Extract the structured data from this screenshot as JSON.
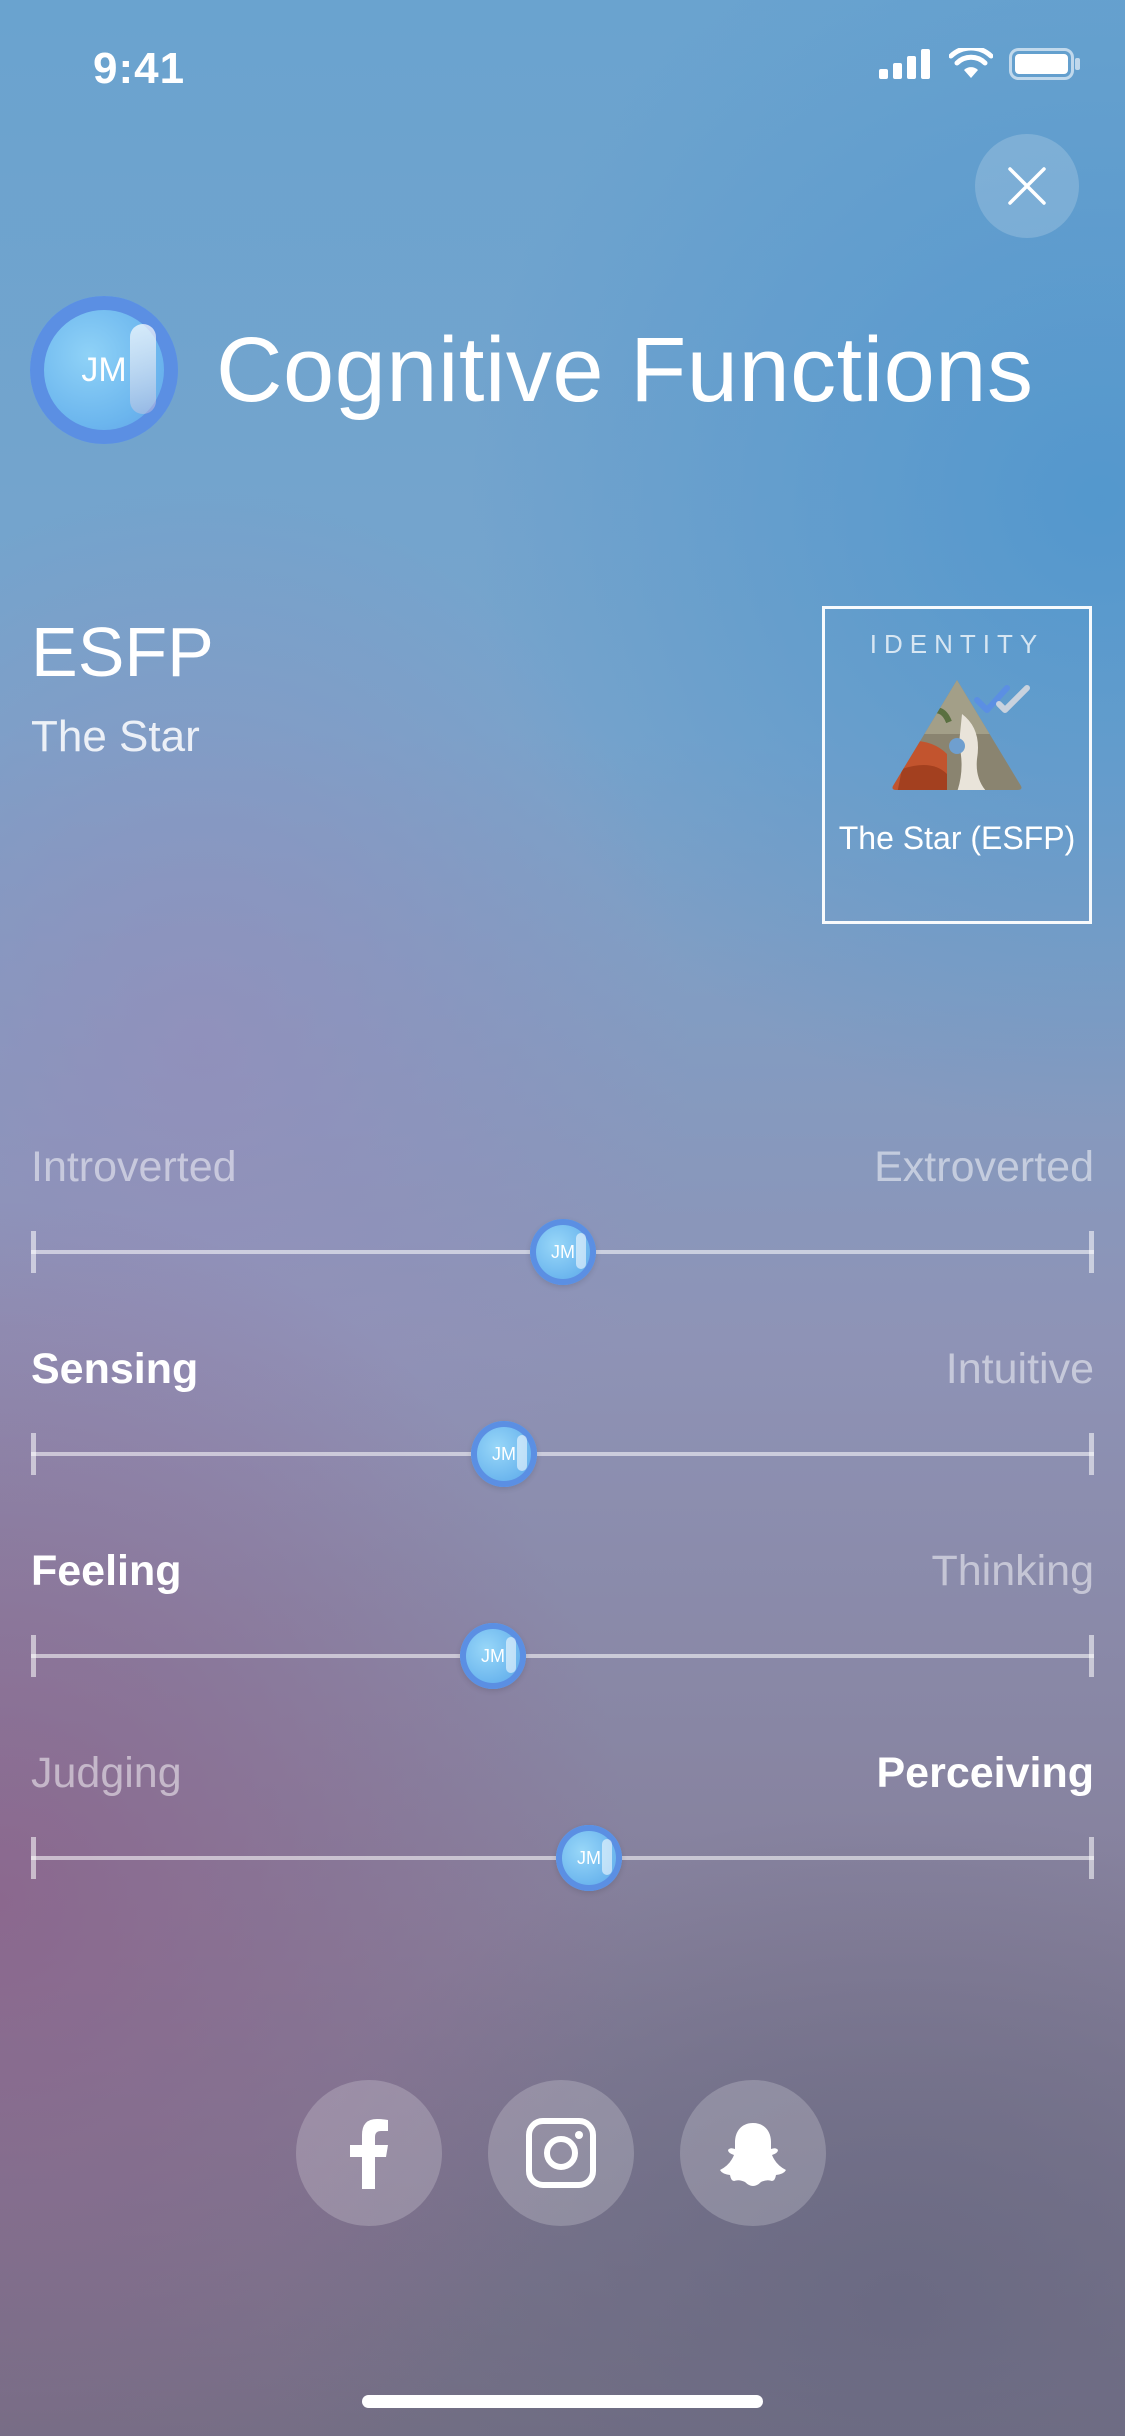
{
  "status_bar": {
    "time": "9:41"
  },
  "header": {
    "avatar_initials": "JM",
    "title": "Cognitive Functions"
  },
  "type": {
    "code": "ESFP",
    "name": "The Star"
  },
  "identity_card": {
    "label": "IDENTITY",
    "caption": "The Star (ESFP)"
  },
  "sliders": [
    {
      "left": "Introverted",
      "right": "Extroverted",
      "active": "none",
      "value": 0.5,
      "thumb_initials": "JM"
    },
    {
      "left": "Sensing",
      "right": "Intuitive",
      "active": "left",
      "value": 0.445,
      "thumb_initials": "JM"
    },
    {
      "left": "Feeling",
      "right": "Thinking",
      "active": "left",
      "value": 0.435,
      "thumb_initials": "JM"
    },
    {
      "left": "Judging",
      "right": "Perceiving",
      "active": "right",
      "value": 0.525,
      "thumb_initials": "JM"
    }
  ],
  "social": [
    "facebook-icon",
    "instagram-icon",
    "snapchat-icon"
  ],
  "colors": {
    "accent_ring": "#5b8fe3",
    "avatar_fill": "#6cb6ee"
  }
}
